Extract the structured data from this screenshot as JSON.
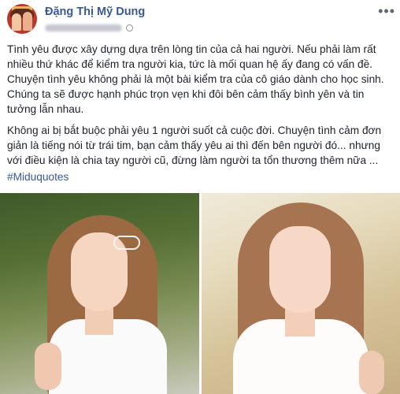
{
  "post": {
    "author": "Đặng Thị Mỹ Dung",
    "more_label": "•••",
    "paragraphs": [
      "Tình yêu được xây dựng dựa trên lòng tin của cả hai người. Nếu phải làm rất nhiều thứ khác để kiểm tra người kia, tức là mối quan hệ ấy đang có vấn đề. Chuyện tình yêu không phải là một bài kiểm tra của cô giáo dành cho học sinh. Chúng ta sẽ được hạnh phúc trọn vẹn khi đôi bên cảm thấy bình yên và tin tưởng lẫn nhau.",
      "Không ai bị bắt buộc phải yêu 1 người suốt cả cuộc đời. Chuyện tình cảm đơn giản là tiếng nói từ trái tim, bạn cảm thấy yêu ai thì đến bên người đó... nhưng với điều kiện là chia tay người cũ, đừng làm người ta tổn thương thêm nữa ..."
    ],
    "hashtag": "#Miduquotes"
  },
  "colors": {
    "author_name": "#385898",
    "hashtag": "#365899",
    "text": "#1d2129"
  },
  "icons": [
    "globe-icon",
    "more-options-icon"
  ]
}
